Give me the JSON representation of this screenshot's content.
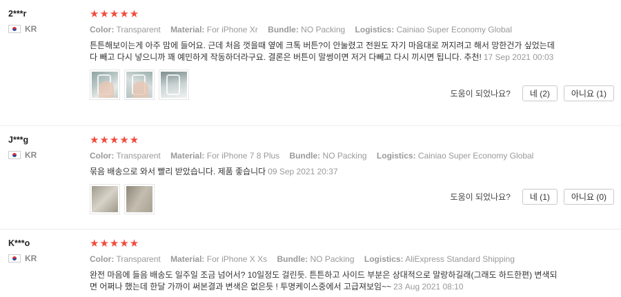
{
  "reviews": [
    {
      "user": "2***r",
      "country": "KR",
      "stars": "★★★★★",
      "specs": [
        {
          "key": "Color:",
          "value": "Transparent"
        },
        {
          "key": "Material:",
          "value": "For iPhone Xr"
        },
        {
          "key": "Bundle:",
          "value": "NO Packing"
        },
        {
          "key": "Logistics:",
          "value": "Cainiao Super Economy Global"
        }
      ],
      "text": "튼튼해보이는게 아주 맘에 들어요. 근데 처음 껏을때 옆에 크톡 버튼?이 안눌렸고 전원도 자기 마음대로 꺼지려고 해서 망한건가 싶었는데 다 빼고 다시 넣으니까 꽤 예민하게 작동하더라구요. 결론은 버튼이 말썽이면 저거 다빼고 다시 끼시면 됩니다. 추천!",
      "date": "17 Sep 2021 00:03",
      "helpful_question": "도움이 되었나요?",
      "yes_label": "네 (2)",
      "no_label": "아니요 (1)"
    },
    {
      "user": "J***g",
      "country": "KR",
      "stars": "★★★★★",
      "specs": [
        {
          "key": "Color:",
          "value": "Transparent"
        },
        {
          "key": "Material:",
          "value": "For iPhone 7 8 Plus"
        },
        {
          "key": "Bundle:",
          "value": "NO Packing"
        },
        {
          "key": "Logistics:",
          "value": "Cainiao Super Economy Global"
        }
      ],
      "text": "묶음 배송으로 와서 빨리 받았습니다. 제품 좋습니다",
      "date": "09 Sep 2021 20:37",
      "helpful_question": "도움이 되었나요?",
      "yes_label": "네 (1)",
      "no_label": "아니요 (0)"
    },
    {
      "user": "K***o",
      "country": "KR",
      "stars": "★★★★★",
      "specs": [
        {
          "key": "Color:",
          "value": "Transparent"
        },
        {
          "key": "Material:",
          "value": "For iPhone X Xs"
        },
        {
          "key": "Bundle:",
          "value": "NO Packing"
        },
        {
          "key": "Logistics:",
          "value": "AliExpress Standard Shipping"
        }
      ],
      "text": "완전 마음에 들음 배송도 일주일 조금 넘어서? 10일정도 걸린듯. 튼튼하고 사이드 부분은 상대적으로 말랑하길래(그래도 하드한편) 변색되면 어쩌나 했는데 한달 가까이 써본결과 변색은 없은듯 ! 투명케이스중에서 고급져보임~~",
      "date": "23 Aug 2021 08:10"
    }
  ]
}
